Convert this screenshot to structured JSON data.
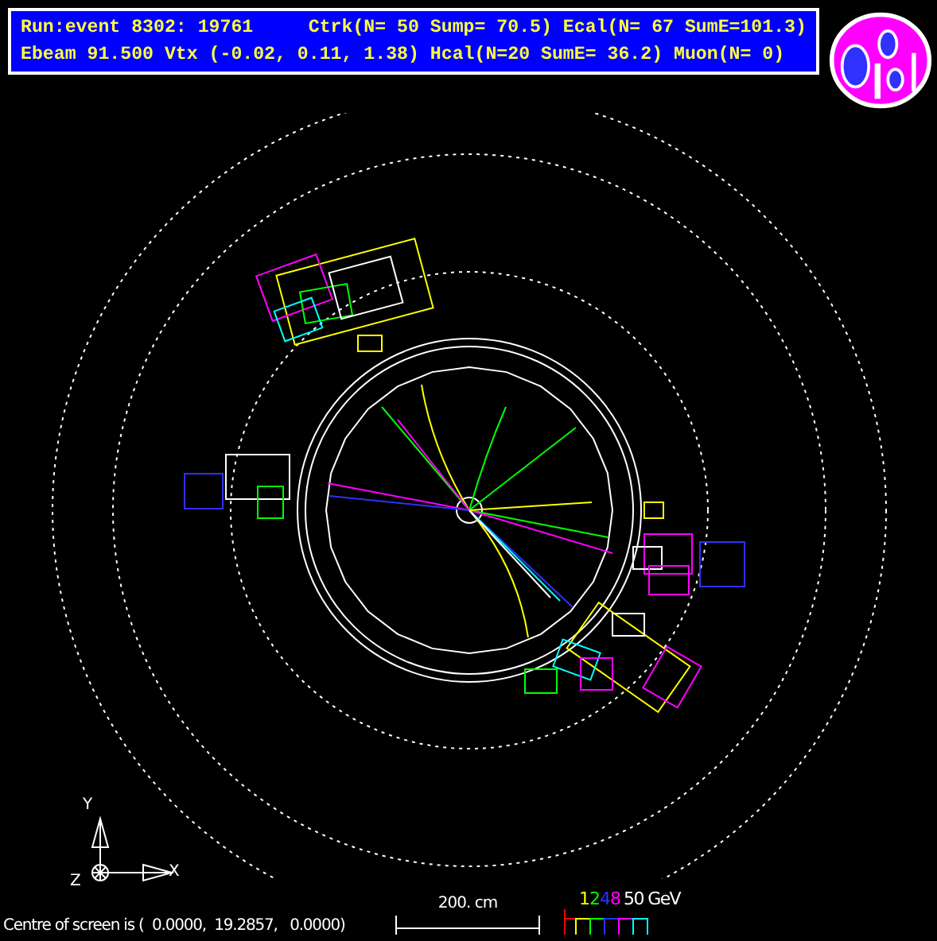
{
  "header": {
    "lines": [
      "Run:event 8302: 19761     Ctrk(N= 50 Sump= 70.5) Ecal(N= 67 SumE=101.3)",
      "Ebeam 91.500 Vtx (-0.02, 0.11, 1.38) Hcal(N=20 SumE= 36.2) Muon(N= 0)"
    ]
  },
  "axes": {
    "y": "Y",
    "x": "X",
    "z": "Z"
  },
  "scale": {
    "label": "200. cm"
  },
  "legend": {
    "items": [
      {
        "label": "1",
        "color": "#ffff00"
      },
      {
        "label": "2",
        "color": "#00ff00"
      },
      {
        "label": "4",
        "color": "#3030ff"
      },
      {
        "label": "8",
        "color": "#ff00ff"
      }
    ],
    "unit": "50 GeV"
  },
  "footer": "Centre of screen is (  0.0000,  19.2857,   0.0000)"
}
